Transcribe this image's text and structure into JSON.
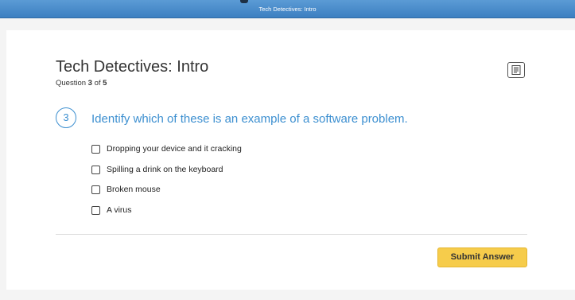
{
  "header": {
    "title": "Tech Detectives: Intro"
  },
  "quiz": {
    "title": "Tech Detectives: Intro",
    "counter_prefix": "Question ",
    "current": "3",
    "counter_mid": " of ",
    "total": "5",
    "notes_icon": "notes-icon"
  },
  "question": {
    "number": "3",
    "text": "Identify which of these is an example of a software problem.",
    "options": [
      "Dropping your device and it cracking",
      "Spilling a drink on the keyboard",
      "Broken mouse",
      "A virus"
    ]
  },
  "actions": {
    "submit_label": "Submit Answer"
  },
  "colors": {
    "accent": "#3c8fd0",
    "submit": "#f6cc4b",
    "topbar": "#4a8ccb"
  }
}
